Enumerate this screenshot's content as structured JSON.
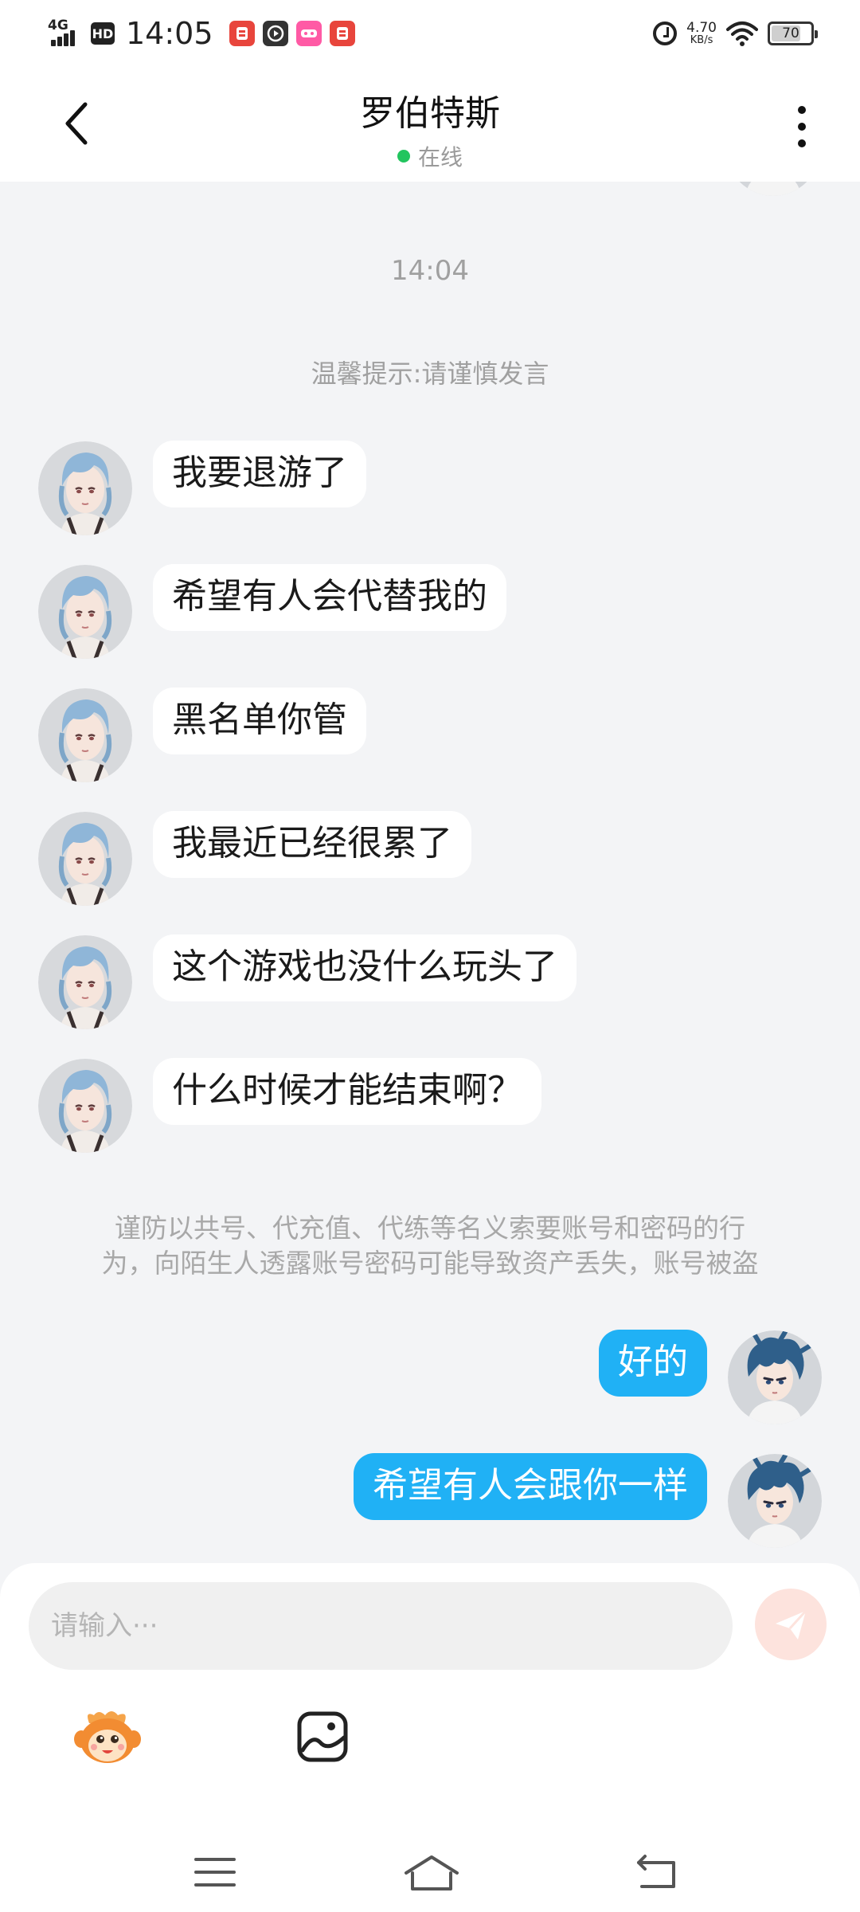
{
  "status_bar": {
    "network": "4G",
    "hd": "HD",
    "time": "14:05",
    "speed_value": "4.70",
    "speed_unit": "KB/s",
    "battery": "70",
    "battery_level": 0.7,
    "app_icons": [
      {
        "name": "app-icon-1",
        "color": "#e8453c"
      },
      {
        "name": "app-icon-2",
        "color": "#333333"
      },
      {
        "name": "app-icon-3",
        "color": "#ff5aa5"
      },
      {
        "name": "app-icon-4",
        "color": "#e8453c"
      }
    ]
  },
  "header": {
    "title": "罗伯特斯",
    "presence": "在线",
    "presence_color": "#22c55e"
  },
  "chat": {
    "timestamp": "14:04",
    "tip": "温馨提示:请谨慎发言",
    "incoming": [
      "我要退游了",
      "希望有人会代替我的",
      "黑名单你管",
      "我最近已经很累了",
      "这个游戏也没什么玩头了",
      "什么时候才能结束啊？"
    ],
    "warning_line1": "谨防以共号、代充值、代练等名义索要账号和密码的行",
    "warning_line2": "为，向陌生人透露账号密码可能导致资产丢失，账号被盗",
    "outgoing": [
      "好的",
      "希望有人会跟你一样"
    ],
    "outgoing_bubble_color": "#20b1f5"
  },
  "composer": {
    "placeholder": "请输入···",
    "send_button_color": "#fde3dd"
  },
  "toolbar": {
    "icons": [
      "mascot-emoji-icon",
      "image-icon"
    ]
  },
  "nav_bar": {
    "icons": [
      "menu-icon",
      "home-icon",
      "back-icon"
    ]
  }
}
